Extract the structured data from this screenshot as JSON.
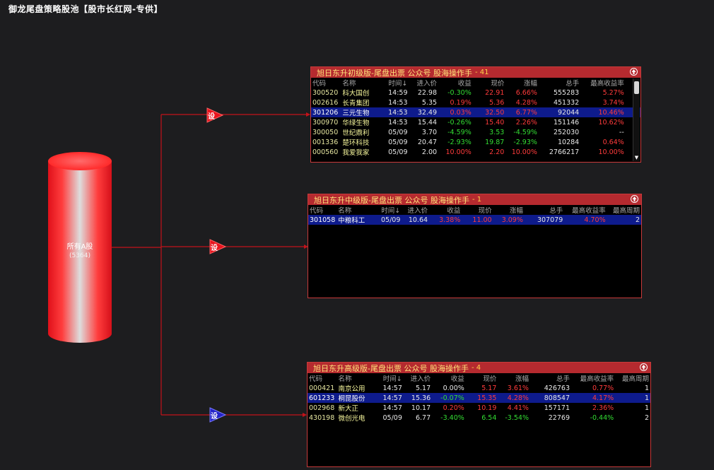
{
  "app_title": "御龙尾盘策略股池【股市长红网-专供】",
  "source": {
    "label": "所有A股",
    "count": "(5364)"
  },
  "strategy_buttons": [
    "设",
    "设",
    "设"
  ],
  "columns_a": [
    "代码",
    "名称",
    "时间↓",
    "进入价",
    "收益",
    "现价",
    "涨幅",
    "总手",
    "最高收益率"
  ],
  "columns_b": [
    "代码",
    "名称",
    "时间↓",
    "进入价",
    "收益",
    "现价",
    "涨幅",
    "总手",
    "最高收益率",
    "最高周期"
  ],
  "panels": [
    {
      "title": "旭日东升初级版-尾盘出票  公众号 股海操作手",
      "count": "- 41",
      "rows": [
        {
          "code": "300520",
          "name": "科大国创",
          "time": "14:59",
          "entry": "22.98",
          "gain": "-0.30%",
          "price": "22.91",
          "chg": "6.66%",
          "vol": "555283",
          "maxret": "5.27%",
          "dir": [
            "dn",
            "up",
            "up",
            "up"
          ]
        },
        {
          "code": "002616",
          "name": "长青集团",
          "time": "14:53",
          "entry": "5.35",
          "gain": "0.19%",
          "price": "5.36",
          "chg": "4.28%",
          "vol": "451332",
          "maxret": "3.74%",
          "dir": [
            "up",
            "up",
            "up",
            "up"
          ]
        },
        {
          "code": "301206",
          "name": "三元生物",
          "time": "14:53",
          "entry": "32.49",
          "gain": "0.03%",
          "price": "32.50",
          "chg": "6.77%",
          "vol": "92044",
          "maxret": "10.46%",
          "dir": [
            "up",
            "up",
            "up",
            "up"
          ],
          "selected": true
        },
        {
          "code": "300970",
          "name": "华绿生物",
          "time": "14:53",
          "entry": "15.44",
          "gain": "-0.26%",
          "price": "15.40",
          "chg": "2.26%",
          "vol": "151146",
          "maxret": "10.62%",
          "dir": [
            "dn",
            "up",
            "up",
            "up"
          ]
        },
        {
          "code": "300050",
          "name": "世纪鼎利",
          "time": "05/09",
          "entry": "3.70",
          "gain": "-4.59%",
          "price": "3.53",
          "chg": "-4.59%",
          "vol": "252030",
          "maxret": "--",
          "dir": [
            "dn",
            "dn",
            "dn",
            "zr"
          ]
        },
        {
          "code": "001336",
          "name": "楚环科技",
          "time": "05/09",
          "entry": "20.47",
          "gain": "-2.93%",
          "price": "19.87",
          "chg": "-2.93%",
          "vol": "10284",
          "maxret": "0.64%",
          "dir": [
            "dn",
            "dn",
            "dn",
            "up"
          ]
        },
        {
          "code": "000560",
          "name": "我爱我家",
          "time": "05/09",
          "entry": "2.00",
          "gain": "10.00%",
          "price": "2.20",
          "chg": "10.00%",
          "vol": "2766217",
          "maxret": "10.00%",
          "dir": [
            "up",
            "up",
            "up",
            "up"
          ]
        }
      ]
    },
    {
      "title": "旭日东升中级版-尾盘出票  公众号 股海操作手",
      "count": "- 1",
      "rows": [
        {
          "code": "301058",
          "name": "中粮科工",
          "time": "05/09",
          "entry": "10.64",
          "gain": "3.38%",
          "price": "11.00",
          "chg": "3.09%",
          "vol": "307079",
          "maxret": "4.70%",
          "period": "2",
          "dir": [
            "up",
            "up",
            "up",
            "up"
          ],
          "selected": true
        }
      ]
    },
    {
      "title": "旭日东升高级版-尾盘出票  公众号 股海操作手",
      "count": "- 4",
      "rows": [
        {
          "code": "000421",
          "name": "南京公用",
          "time": "14:57",
          "entry": "5.17",
          "gain": "0.00%",
          "price": "5.17",
          "chg": "3.61%",
          "vol": "426763",
          "maxret": "0.77%",
          "period": "1",
          "dir": [
            "zr",
            "up",
            "up",
            "up"
          ]
        },
        {
          "code": "601233",
          "name": "桐昆股份",
          "time": "14:57",
          "entry": "15.36",
          "gain": "-0.07%",
          "price": "15.35",
          "chg": "4.28%",
          "vol": "808547",
          "maxret": "4.17%",
          "period": "1",
          "dir": [
            "dn",
            "up",
            "up",
            "up"
          ],
          "selected": true
        },
        {
          "code": "002968",
          "name": "新大正",
          "time": "14:57",
          "entry": "10.17",
          "gain": "0.20%",
          "price": "10.19",
          "chg": "4.41%",
          "vol": "157171",
          "maxret": "2.36%",
          "period": "1",
          "dir": [
            "up",
            "up",
            "up",
            "up"
          ]
        },
        {
          "code": "430198",
          "name": "微创光电",
          "time": "05/09",
          "entry": "6.77",
          "gain": "-3.40%",
          "price": "6.54",
          "chg": "-3.54%",
          "vol": "22769",
          "maxret": "-0.44%",
          "period": "2",
          "dir": [
            "dn",
            "dn",
            "dn",
            "dn"
          ]
        }
      ]
    }
  ],
  "colors": {
    "rise": "#ff3b3b",
    "fall": "#33dd33",
    "flat": "#e8e8e8",
    "header_bar": "#b52a2f",
    "selected_row": "#0e1b8c"
  }
}
